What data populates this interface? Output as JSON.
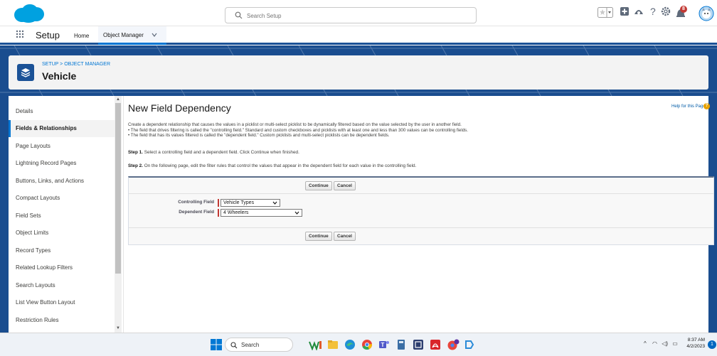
{
  "search": {
    "placeholder": "Search Setup"
  },
  "topbar": {
    "notification_count": "8"
  },
  "nav": {
    "app_name": "Setup",
    "home_label": "Home",
    "object_manager_label": "Object Manager"
  },
  "header": {
    "breadcrumb": "SETUP > OBJECT MANAGER",
    "object_name": "Vehicle"
  },
  "sidebar": {
    "items": [
      {
        "label": "Details"
      },
      {
        "label": "Fields & Relationships",
        "active": true
      },
      {
        "label": "Page Layouts"
      },
      {
        "label": "Lightning Record Pages"
      },
      {
        "label": "Buttons, Links, and Actions"
      },
      {
        "label": "Compact Layouts"
      },
      {
        "label": "Field Sets"
      },
      {
        "label": "Object Limits"
      },
      {
        "label": "Record Types"
      },
      {
        "label": "Related Lookup Filters"
      },
      {
        "label": "Search Layouts"
      },
      {
        "label": "List View Button Layout"
      },
      {
        "label": "Restriction Rules"
      }
    ]
  },
  "main": {
    "title": "New Field Dependency",
    "help_link": "Help for this Page",
    "description_lines": [
      "Create a dependent relationship that causes the values in a picklist or multi-select picklist to be dynamically filtered based on the value selected by the user in another field.",
      "• The field that drives filtering is called the \"controlling field.\" Standard and custom checkboxes and picklists with at least one and less than 300 values can be controlling fields.",
      "• The field that has its values filtered is called the \"dependent field.\" Custom picklists and multi-select picklists can be dependent fields."
    ],
    "step1_label": "Step 1.",
    "step1_text": " Select a controlling field and a dependent field. Click Continue when finished.",
    "step2_label": "Step 2.",
    "step2_text": " On the following page, edit the filter rules that control the values that appear in the dependent field for each value in the controlling field.",
    "continue_label": "Continue",
    "cancel_label": "Cancel",
    "controlling_field_label": "Controlling Field",
    "controlling_field_value": "Vehicle Types",
    "dependent_field_label": "Dependent Field",
    "dependent_field_value": "4 Wheelers"
  },
  "taskbar": {
    "search_label": "Search",
    "time": "8:37 AM",
    "date": "4/2/2023",
    "notification_count": "1"
  },
  "colors": {
    "brand_blue": "#0176d3",
    "banner_blue": "#1a4d8f",
    "required_red": "#c23934"
  }
}
